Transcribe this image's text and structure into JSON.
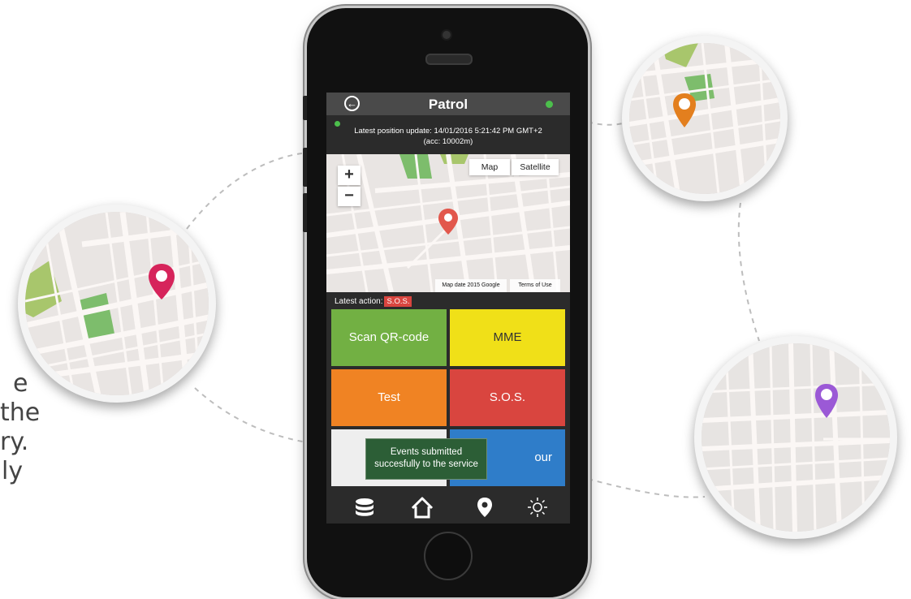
{
  "side_text": [
    "e",
    "the",
    "ry.",
    "ly"
  ],
  "app": {
    "title": "Patrol",
    "position_update_line1": "Latest position update: 14/01/2016 5:21:42 PM GMT+2",
    "position_update_line2": "(acc: 10002m)",
    "status_color": "#4cbf4c"
  },
  "map": {
    "zoom_in": "+",
    "zoom_out": "−",
    "type_map": "Map",
    "type_satellite": "Satellite",
    "attribution": "Map date 2015 Google",
    "terms": "Terms of Use",
    "pin_color": "#e2574c"
  },
  "latest_action": {
    "label": "Latest action:",
    "value": "S.O.S.",
    "color": "#d9453f"
  },
  "tiles": [
    {
      "label": "Scan QR-code",
      "color": "#72b043"
    },
    {
      "label": "MME",
      "color": "#f0e018"
    },
    {
      "label": "Test",
      "color": "#f08323"
    },
    {
      "label": "S.O.S.",
      "color": "#d9453f"
    },
    {
      "label": "",
      "color": "#eeeeee"
    },
    {
      "label": "our",
      "color": "#2f7dc9"
    }
  ],
  "toast": {
    "line1": "Events submitted",
    "line2": "succesfully to the service"
  },
  "bottom_nav": [
    {
      "icon": "database-icon"
    },
    {
      "icon": "home-icon"
    },
    {
      "icon": "location-pin-icon"
    },
    {
      "icon": "brightness-icon"
    }
  ],
  "map_circles": [
    {
      "pin_color": "#d6245b"
    },
    {
      "pin_color": "#e37f1e"
    },
    {
      "pin_color": "#9b59d6"
    }
  ]
}
